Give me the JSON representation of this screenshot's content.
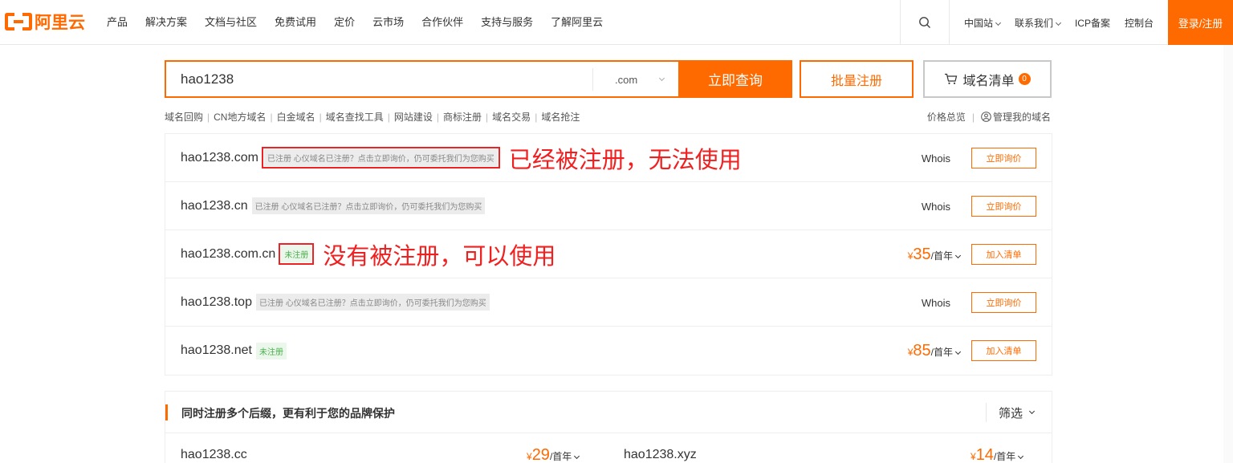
{
  "brand": {
    "name": "阿里云",
    "color": "#ff6a00"
  },
  "nav": [
    "产品",
    "解决方案",
    "文档与社区",
    "免费试用",
    "定价",
    "云市场",
    "合作伙伴",
    "支持与服务",
    "了解阿里云"
  ],
  "nav_right": {
    "search_icon": "search-icon",
    "region": "中国站",
    "contact": "联系我们",
    "icp": "ICP备案",
    "console": "控制台",
    "login": "登录/注册"
  },
  "search": {
    "value": "hao1238",
    "suffix": ".com",
    "query_label": "立即查询",
    "batch_label": "批量注册",
    "cart_label": "域名清单",
    "cart_count": "0"
  },
  "quick_links": [
    "域名回购",
    "CN地方域名",
    "白金域名",
    "域名查找工具",
    "网站建设",
    "商标注册",
    "域名交易",
    "域名抢注"
  ],
  "quick_links_right": {
    "price_overview": "价格总览",
    "manage": "管理我的域名"
  },
  "results": [
    {
      "domain": "hao1238.com",
      "status": "已注册 心仪域名已注册？点击立即询价，仍可委托我们为您购买",
      "annotation": "已经被注册，无法使用",
      "whois": "Whois",
      "action": "立即询价"
    },
    {
      "domain": "hao1238.cn",
      "status": "已注册 心仪域名已注册？点击立即询价，仍可委托我们为您购买",
      "whois": "Whois",
      "action": "立即询价"
    },
    {
      "domain": "hao1238.com.cn",
      "status": "未注册",
      "annotation": "没有被注册，可以使用",
      "currency": "¥",
      "price": "35",
      "unit": "/首年",
      "action": "加入清单"
    },
    {
      "domain": "hao1238.top",
      "status": "已注册 心仪域名已注册？点击立即询价，仍可委托我们为您购买",
      "whois": "Whois",
      "action": "立即询价"
    },
    {
      "domain": "hao1238.net",
      "status": "未注册",
      "currency": "¥",
      "price": "85",
      "unit": "/首年",
      "action": "加入清单"
    }
  ],
  "bundle": {
    "title": "同时注册多个后缀，更有利于您的品牌保护",
    "filter": "筛选",
    "items": [
      {
        "domain": "hao1238.cc",
        "currency": "¥",
        "price": "29",
        "unit": "/首年"
      },
      {
        "domain": "hao1238.xyz",
        "currency": "¥",
        "price": "14",
        "unit": "/首年"
      }
    ]
  }
}
